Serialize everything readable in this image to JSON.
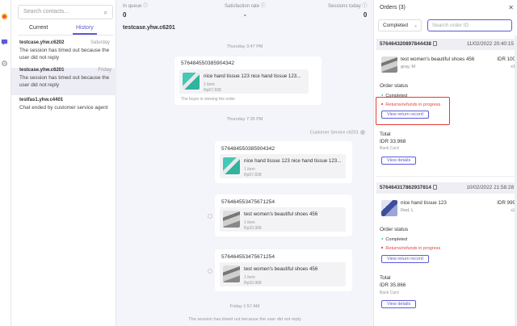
{
  "contacts": {
    "search_placeholder": "Search contacts...",
    "tabs": [
      "Current",
      "History"
    ],
    "sessions": [
      {
        "name": "testcase.yhw.c6202",
        "day": "Saturday",
        "message": "The session has timed out because the user did not reply"
      },
      {
        "name": "testcase.yhw.c6201",
        "day": "Friday",
        "message": "The session has timed out because the user did not reply"
      },
      {
        "name": "testfas1.yhw.c4401",
        "day": "",
        "message": "Chat ended by customer service agent"
      }
    ]
  },
  "stats": [
    {
      "label": "In queue ⓘ",
      "value": "0"
    },
    {
      "label": "Satisfaction rate ⓘ",
      "value": "-"
    },
    {
      "label": "Sessions today ⓘ",
      "value": "0"
    }
  ],
  "chat": {
    "user": "testcase.yhw.c6201",
    "timestamps": [
      "Thursday 3:47 PM",
      "Thursday 7:35 PM",
      "Friday 1:57 AM"
    ],
    "agent_label": "Customer Service c6201",
    "messages": [
      {
        "order_id": "576484550385904342",
        "title": "nice hand tissue 123 nice hand tissue 123...",
        "qty": "1 item",
        "price": "Rp67.838",
        "note": "The buyer is viewing the order"
      },
      {
        "order_id": "576484550385904342",
        "title": "nice hand tissue 123 nice hand tissue 123...",
        "qty": "1 item",
        "price": "Rp67.838"
      },
      {
        "order_id": "576464553475671254",
        "title": "test women's beautiful shoes 456",
        "qty": "1 item",
        "price": "Rp33.968"
      },
      {
        "order_id": "576464553475671254",
        "title": "test women's beautiful shoes 456",
        "qty": "1 item",
        "price": "Rp33.968"
      }
    ],
    "bottom_note": "The session has timed out because the user did not reply"
  },
  "orders": {
    "title": "Orders (3)",
    "filter_value": "Completed",
    "search_placeholder": "Search order ID",
    "list": [
      {
        "id": "576464320897844438",
        "date": "11/02/2022 20:40:15",
        "item": "test women's beautiful shoes 456",
        "variant": "gray, M",
        "price": "IDR 100",
        "qty": "x1",
        "status_title": "Order status",
        "status_completed": "Completed",
        "status_returns": "Returns/refunds in progress",
        "return_button": "View return record",
        "total_label": "Total",
        "total": "IDR 33.968",
        "payment": "Bank Card",
        "details_button": "View details"
      },
      {
        "id": "576464317862937814",
        "date": "10/02/2022 21:58:28",
        "item": "nice hand tissue 123",
        "variant": "Red, L",
        "price": "IDR 999",
        "qty": "x2",
        "status_title": "Order status",
        "status_completed": "Completed",
        "status_returns": "Returns/refunds in progress",
        "return_button": "View return record",
        "total_label": "Total",
        "total": "IDR 35.866",
        "payment": "Bank Card",
        "details_button": "View details"
      }
    ]
  },
  "colors": {
    "accent": "#5b5bd6",
    "error": "#e53935",
    "success": "#2bb673"
  }
}
